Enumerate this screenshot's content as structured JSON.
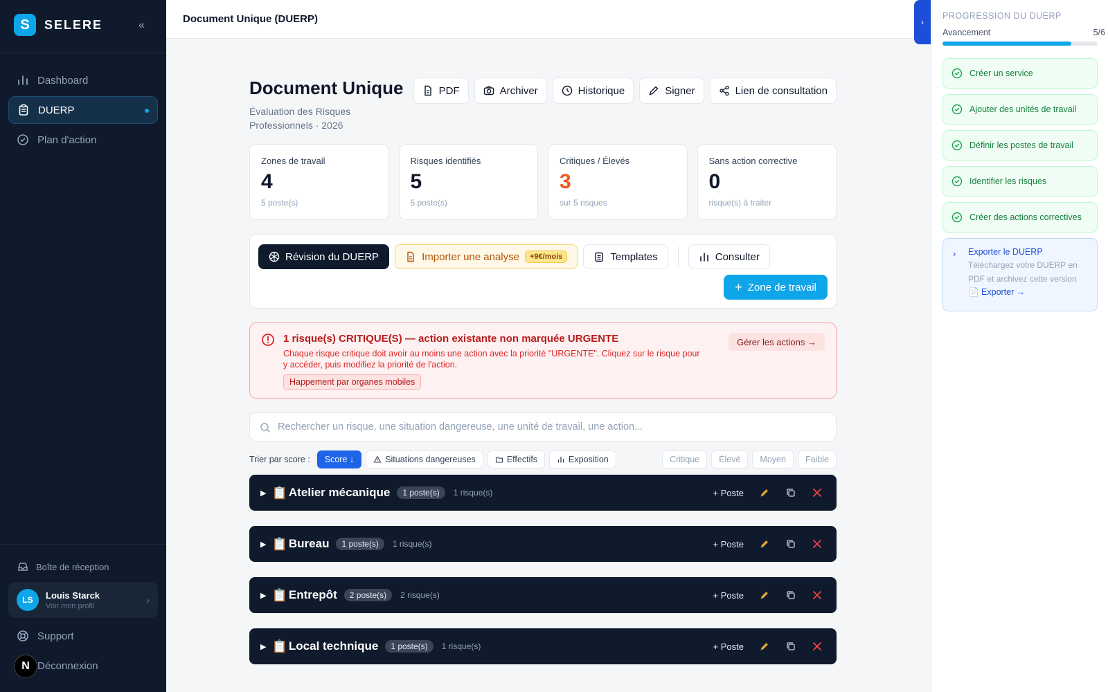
{
  "sidebar": {
    "brand": "SELERE",
    "brand_mark": "S",
    "collapse": "«",
    "items": [
      {
        "label": "Dashboard"
      },
      {
        "label": "DUERP"
      },
      {
        "label": "Plan d'action"
      }
    ],
    "inbox": "Boîte de réception",
    "user": {
      "initials": "LS",
      "name": "Louis Starck",
      "sub": "Voir mon profil"
    },
    "support": "Support",
    "logout": "Déconnexion",
    "n_badge": "N"
  },
  "topbar": {
    "title": "Document Unique (DUERP)"
  },
  "panel_toggle": "›",
  "header": {
    "title": "Document Unique",
    "subtitle": "Évaluation des Risques Professionnels · 2026",
    "actions": [
      "PDF",
      "Archiver",
      "Historique",
      "Signer",
      "Lien de consultation"
    ]
  },
  "stats": [
    {
      "label": "Zones de travail",
      "value": "4",
      "sub": "5 poste(s)"
    },
    {
      "label": "Risques identifiés",
      "value": "5",
      "sub": "5 poste(s)"
    },
    {
      "label": "Critiques / Élevés",
      "value": "3",
      "sub": "sur 5 risques"
    },
    {
      "label": "Sans action corrective",
      "value": "0",
      "sub": "risque(s) à traiter"
    }
  ],
  "toolbar": {
    "revision": "Révision du DUERP",
    "import": "Importer une analyse",
    "import_price": "+9€/mois",
    "templates": "Templates",
    "consult": "Consulter",
    "add_zone": "Zone de travail"
  },
  "alert": {
    "title": "1 risque(s) CRITIQUE(S) — action existante non marquée URGENTE",
    "text": "Chaque risque critique doit avoir au moins une action avec la priorité \"URGENTE\". Cliquez sur le risque pour y accéder, puis modifiez la priorité de l'action.",
    "tag": "Happement par organes mobiles",
    "button": "Gérer les actions →"
  },
  "search": {
    "placeholder": "Rechercher un risque, une situation dangereuse, une unité de travail, une action..."
  },
  "sort": {
    "label": "Trier par score :",
    "score": "Score ↓",
    "situations": "Situations dangereuses",
    "effectifs": "Effectifs",
    "exposition": "Exposition",
    "levels": [
      "Critique",
      "Élevé",
      "Moyen",
      "Faible"
    ]
  },
  "zones": [
    {
      "name": "Atelier mécanique",
      "postes": "1 poste(s)",
      "risques": "1 risque(s)"
    },
    {
      "name": "Bureau",
      "postes": "1 poste(s)",
      "risques": "1 risque(s)"
    },
    {
      "name": "Entrepôt",
      "postes": "2 poste(s)",
      "risques": "2 risque(s)"
    },
    {
      "name": "Local technique",
      "postes": "1 poste(s)",
      "risques": "1 risque(s)"
    }
  ],
  "zone_action_label": "+ Poste",
  "progress": {
    "heading": "PROGRESSION DU DUERP",
    "label": "Avancement",
    "count": "5/6",
    "fraction": 0.83,
    "steps": [
      "Créer un service",
      "Ajouter des unités de travail",
      "Définir les postes de travail",
      "Identifier les risques",
      "Créer des actions correctives"
    ],
    "current": {
      "title": "Exporter le DUERP",
      "text": "Téléchargez votre DUERP en PDF et archivez cette version",
      "link": "📄 Exporter →"
    }
  },
  "colors": {
    "accent": "#0ea5e9",
    "sidebar": "#0f1b2d",
    "critical": "#dc2626",
    "success": "#15803d"
  }
}
